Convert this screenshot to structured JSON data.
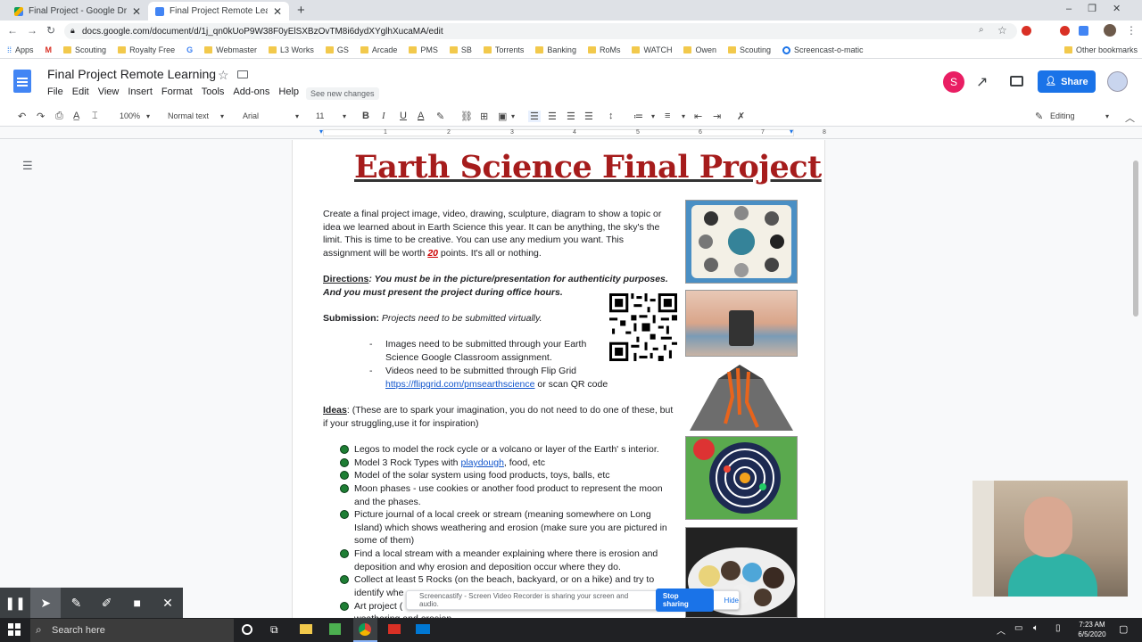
{
  "browser": {
    "tabs": [
      {
        "title": "Final Project - Google Drive",
        "active": false
      },
      {
        "title": "Final Project Remote Learning - G",
        "active": true
      }
    ],
    "new_tab": "+",
    "url": "docs.google.com/document/d/1j_qn0kUoP9W38F0yElSXBzOvTM8i6dydXYglhXucaMA/edit",
    "bookmarks": [
      "Apps",
      "Scouting",
      "Royalty Free",
      "Webmaster",
      "L3 Works",
      "GS",
      "Arcade",
      "PMS",
      "SB",
      "Torrents",
      "Banking",
      "RoMs",
      "WATCH",
      "Owen",
      "Scouting",
      "Screencast-o-matic"
    ],
    "other_bookmarks": "Other bookmarks"
  },
  "docs": {
    "title": "Final Project Remote Learning",
    "menu": [
      "File",
      "Edit",
      "View",
      "Insert",
      "Format",
      "Tools",
      "Add-ons",
      "Help"
    ],
    "see_changes": "See new changes",
    "avatar_letter": "S",
    "share_label": "Share",
    "toolbar": {
      "zoom": "100%",
      "style": "Normal text",
      "font": "Arial",
      "size": "11",
      "mode": "Editing"
    },
    "ruler_numbers": [
      "1",
      "2",
      "3",
      "4",
      "5",
      "6",
      "7",
      "8"
    ]
  },
  "document": {
    "title": "Earth Science Final Project",
    "intro": "Create a final project image, video, drawing, sculpture, diagram to show a topic or idea we learned about in Earth Science this year. It can be anything, the sky's the limit. This is time to be creative. You can use any medium you want. This assignment will be worth ",
    "points": "20",
    "intro_end": " points. It's all or nothing.",
    "directions_label": "Directions",
    "directions_text": ": You must be in the picture/presentation for authenticity purposes. And you must present the project during office hours.",
    "submission_label": "Submission:",
    "submission_text": " Projects need to be submitted virtually.",
    "sub_items": [
      "Images need to be submitted through your Earth Science Google Classroom assignment.",
      "Videos need to be submitted through Flip Grid"
    ],
    "flipgrid_link": "https://flipgrid.com/pmsearthscience",
    "flipgrid_suffix": " or scan QR code",
    "ideas_label": "Ideas",
    "ideas_text": ": (These are to spark your imagination, you do not need to do one of these, but if your struggling,use it for inspiration)",
    "ideas": [
      {
        "text": "Legos to model the rock cycle or a volcano or layer of the Earth' s interior."
      },
      {
        "pre": "Model 3 Rock Types with ",
        "link": "playdough",
        "post": ", food, etc"
      },
      {
        "text": "Model of the solar system using food products, toys, balls, etc"
      },
      {
        "text": "Moon phases - use cookies or another food product to represent the moon and the phases."
      },
      {
        "text": "Picture journal of a  local creek or stream (meaning somewhere on Long Island) which shows weathering and erosion (make sure you are pictured in some of them)"
      },
      {
        "text": "Find a local stream with a meander explaining where there is erosion and deposition and why erosion and deposition occur where they do."
      },
      {
        "text": "Collect at least 5 Rocks (on the beach, backyard, or on a hike) and try to identify whe"
      },
      {
        "text": "Art project ("
      }
    ],
    "partial_line": "weathering and erosion"
  },
  "screen_share": {
    "message": "Screencastify - Screen Video Recorder is sharing your screen and audio.",
    "stop": "Stop sharing",
    "hide": "Hide"
  },
  "taskbar": {
    "search": "Search here",
    "time": "7:23 AM",
    "date": "6/5/2020"
  }
}
